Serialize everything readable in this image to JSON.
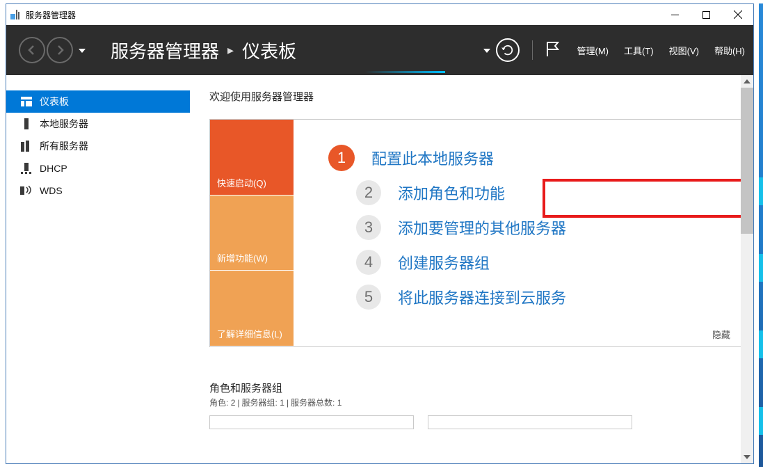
{
  "titlebar": {
    "title": "服务器管理器"
  },
  "breadcrumb": {
    "root": "服务器管理器",
    "page": "仪表板"
  },
  "menu": {
    "manage": "管理(M)",
    "tools": "工具(T)",
    "view": "视图(V)",
    "help": "帮助(H)"
  },
  "sidebar": {
    "items": [
      {
        "label": "仪表板"
      },
      {
        "label": "本地服务器"
      },
      {
        "label": "所有服务器"
      },
      {
        "label": "DHCP"
      },
      {
        "label": "WDS"
      }
    ]
  },
  "welcome": {
    "title": "欢迎使用服务器管理器",
    "blocks": {
      "quickstart": "快速启动(Q)",
      "whatsnew": "新增功能(W)",
      "learnmore": "了解详细信息(L)"
    },
    "tasks": [
      {
        "num": "1",
        "text": "配置此本地服务器"
      },
      {
        "num": "2",
        "text": "添加角色和功能"
      },
      {
        "num": "3",
        "text": "添加要管理的其他服务器"
      },
      {
        "num": "4",
        "text": "创建服务器组"
      },
      {
        "num": "5",
        "text": "将此服务器连接到云服务"
      }
    ],
    "hide": "隐藏"
  },
  "roles": {
    "title": "角色和服务器组",
    "sub_roles_label": "角色:",
    "sub_roles_count": "2",
    "sub_groups_label": "服务器组:",
    "sub_groups_count": "1",
    "sub_total_label": "服务器总数:",
    "sub_total_count": "1"
  }
}
